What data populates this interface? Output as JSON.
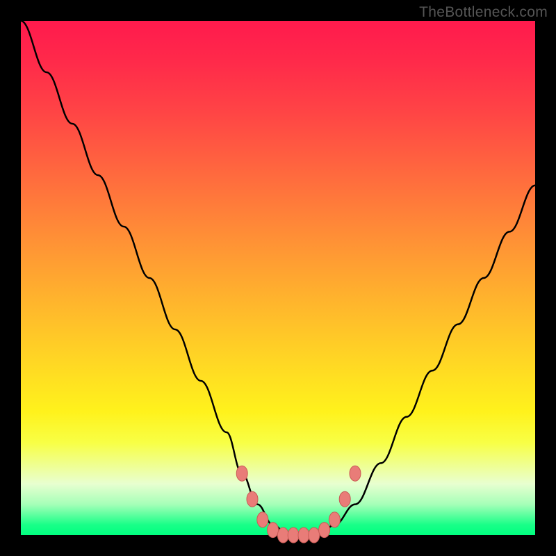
{
  "watermark": "TheBottleneck.com",
  "chart_data": {
    "type": "line",
    "title": "",
    "xlabel": "",
    "ylabel": "",
    "xlim": [
      0,
      100
    ],
    "ylim": [
      0,
      100
    ],
    "background_gradient": {
      "top_color": "#ff1a4d",
      "mid_color": "#ffe21c",
      "bottom_color": "#00ff80",
      "meaning": "red=high bottleneck, green=low bottleneck"
    },
    "series": [
      {
        "name": "bottleneck-curve",
        "x": [
          0,
          5,
          10,
          15,
          20,
          25,
          30,
          35,
          40,
          43,
          46,
          49,
          52,
          55,
          58,
          61,
          65,
          70,
          75,
          80,
          85,
          90,
          95,
          100
        ],
        "y": [
          100,
          90,
          80,
          70,
          60,
          50,
          40,
          30,
          20,
          12,
          6,
          2,
          0,
          0,
          0,
          2,
          6,
          14,
          23,
          32,
          41,
          50,
          59,
          68
        ],
        "color": "#000000"
      }
    ],
    "markers": {
      "name": "optimal-range-markers",
      "color": "#e97c78",
      "points": [
        {
          "x": 43,
          "y": 12
        },
        {
          "x": 45,
          "y": 7
        },
        {
          "x": 47,
          "y": 3
        },
        {
          "x": 49,
          "y": 1
        },
        {
          "x": 51,
          "y": 0
        },
        {
          "x": 53,
          "y": 0
        },
        {
          "x": 55,
          "y": 0
        },
        {
          "x": 57,
          "y": 0
        },
        {
          "x": 59,
          "y": 1
        },
        {
          "x": 61,
          "y": 3
        },
        {
          "x": 63,
          "y": 7
        },
        {
          "x": 65,
          "y": 12
        }
      ]
    }
  }
}
